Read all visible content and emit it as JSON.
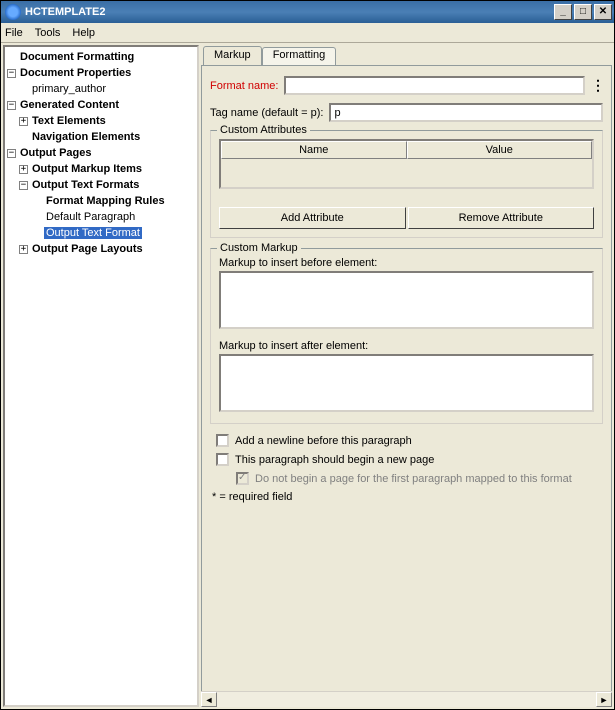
{
  "window": {
    "title": "HCTEMPLATE2"
  },
  "menu": {
    "file": "File",
    "tools": "Tools",
    "help": "Help"
  },
  "tree": {
    "docformatting": "Document Formatting",
    "docprops": "Document Properties",
    "primary_author": "primary_author",
    "gencontent": "Generated Content",
    "textelements": "Text Elements",
    "navelements": "Navigation Elements",
    "outputpages": "Output Pages",
    "markupitems": "Output Markup Items",
    "textformats": "Output Text Formats",
    "mappingrules": "Format Mapping Rules",
    "defaultpara": "Default Paragraph",
    "outtextformat": "Output Text Format",
    "pagelayouts": "Output Page Layouts"
  },
  "tabs": {
    "markup": "Markup",
    "formatting": "Formatting"
  },
  "form": {
    "formatname_label": "Format name:",
    "formatname_value": "",
    "tagname_label": "Tag name (default = p):",
    "tagname_value": "p"
  },
  "customattrs": {
    "legend": "Custom Attributes",
    "col_name": "Name",
    "col_value": "Value",
    "addbtn": "Add Attribute",
    "removebtn": "Remove Attribute"
  },
  "custommarkup": {
    "legend": "Custom Markup",
    "before_label": "Markup to insert before element:",
    "before_value": "",
    "after_label": "Markup to insert after element:",
    "after_value": ""
  },
  "checkboxes": {
    "newline": "Add a newline before this paragraph",
    "newpage": "This paragraph should begin a new page",
    "notfirst": "Do not begin a page for the first paragraph mapped to this format"
  },
  "footnote": "* = required field"
}
